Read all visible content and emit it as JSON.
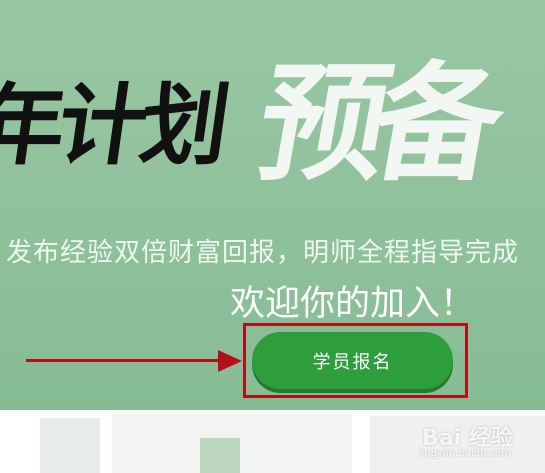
{
  "banner": {
    "calligraphy_black": "年计划",
    "calligraphy_white": "预备",
    "subline": "发布经验双倍财富回报，明师全程指导完成",
    "welcome": "欢迎你的加入！",
    "signup_button": "学员报名"
  },
  "colors": {
    "background": "#93c39d",
    "button": "#2e9e3d",
    "highlight": "#b40f16"
  },
  "watermark": {
    "text": "Bai 经验",
    "sub": "jingyan.baidu.com"
  }
}
